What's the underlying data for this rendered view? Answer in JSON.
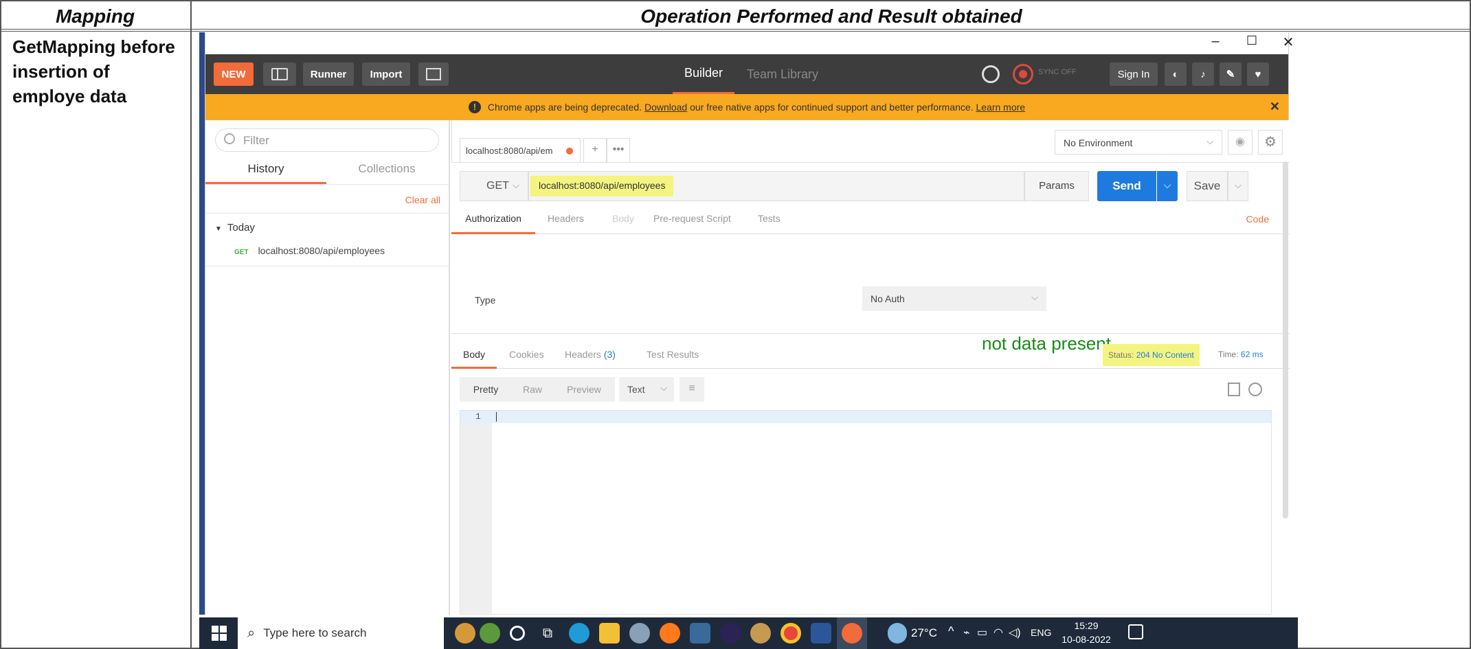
{
  "doc": {
    "col1_header": "Mapping",
    "col2_header": "Operation Performed and Result obtained",
    "mapping_label": "GetMapping before insertion of employe data"
  },
  "window": {
    "minimize": "–",
    "maximize": "☐",
    "close": "✕"
  },
  "toolbar": {
    "new_label": "NEW",
    "runner_label": "Runner",
    "import_label": "Import",
    "tab_builder": "Builder",
    "tab_team_library": "Team Library",
    "sync_label": "SYNC OFF",
    "signin_label": "Sign In"
  },
  "banner": {
    "text_before": "Chrome apps are being deprecated.",
    "download_link": "Download",
    "text_after": "our free native apps for continued support and better performance.",
    "learn_more": "Learn more"
  },
  "sidebar": {
    "filter_placeholder": "Filter",
    "tab_history": "History",
    "tab_collections": "Collections",
    "clear_all": "Clear all",
    "group_today": "Today",
    "history_items": [
      {
        "method": "GET",
        "url": "localhost:8080/api/employees"
      }
    ]
  },
  "request": {
    "tab_label": "localhost:8080/api/em",
    "environment": "No Environment",
    "method": "GET",
    "url": "localhost:8080/api/employees",
    "params_label": "Params",
    "send_label": "Send",
    "save_label": "Save",
    "subtabs": [
      "Authorization",
      "Headers",
      "Body",
      "Pre-request Script",
      "Tests"
    ],
    "code_label": "Code",
    "type_label": "Type",
    "auth_value": "No Auth"
  },
  "response": {
    "annotation": "not data present",
    "tab_body": "Body",
    "tab_cookies": "Cookies",
    "tab_headers": "Headers",
    "headers_count": "(3)",
    "tab_test_results": "Test Results",
    "status_label": "Status:",
    "status_value": "204 No Content",
    "time_label": "Time:",
    "time_value": "62 ms",
    "view_pretty": "Pretty",
    "view_raw": "Raw",
    "view_preview": "Preview",
    "format": "Text",
    "line_number": "1"
  },
  "taskbar": {
    "search_placeholder": "Type here to search",
    "temperature": "27°C",
    "language": "ENG",
    "time": "15:29",
    "date": "10-08-2022"
  },
  "colors": {
    "orange": "#f26b3a",
    "blue": "#1f7ae0",
    "highlight": "#f4f480",
    "banner": "#f9a91f",
    "annotation_green": "#1a8a1a"
  }
}
